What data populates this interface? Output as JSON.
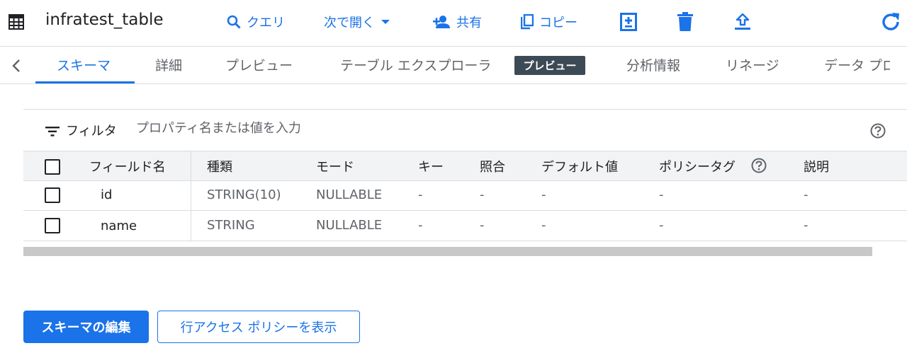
{
  "header": {
    "table_name": "infratest_table",
    "actions": {
      "query": "クエリ",
      "open_with": "次で開く",
      "share": "共有",
      "copy": "コピー"
    }
  },
  "tabs": [
    {
      "label": "スキーマ",
      "active": true
    },
    {
      "label": "詳細"
    },
    {
      "label": "プレビュー"
    },
    {
      "label": "テーブル エクスプローラ"
    },
    {
      "label": "分析情報"
    },
    {
      "label": "リネージ"
    },
    {
      "label": "データ プロ"
    }
  ],
  "preview_badge": "プレビュー",
  "filter": {
    "label": "フィルタ",
    "placeholder": "プロパティ名または値を入力"
  },
  "table": {
    "columns": [
      "フィールド名",
      "種類",
      "モード",
      "キー",
      "照合",
      "デフォルト値",
      "ポリシータグ",
      "説明"
    ],
    "rows": [
      [
        "id",
        "STRING(10)",
        "NULLABLE",
        "-",
        "-",
        "-",
        "-",
        "-"
      ],
      [
        "name",
        "STRING",
        "NULLABLE",
        "-",
        "-",
        "-",
        "-",
        "-"
      ]
    ]
  },
  "buttons": {
    "edit_schema": "スキーマの編集",
    "row_access_policy": "行アクセス ポリシーを表示"
  },
  "colors": {
    "accent": "#1a73e8",
    "badge_bg": "#3c4a55",
    "header_bg": "#f1f3f4"
  },
  "icons": [
    "table-icon",
    "search-icon",
    "dropdown-icon",
    "person-add-icon",
    "copy-icon",
    "add-box-icon",
    "delete-icon",
    "upload-icon",
    "refresh-icon",
    "chevron-left-icon",
    "filter-icon",
    "help-icon"
  ]
}
